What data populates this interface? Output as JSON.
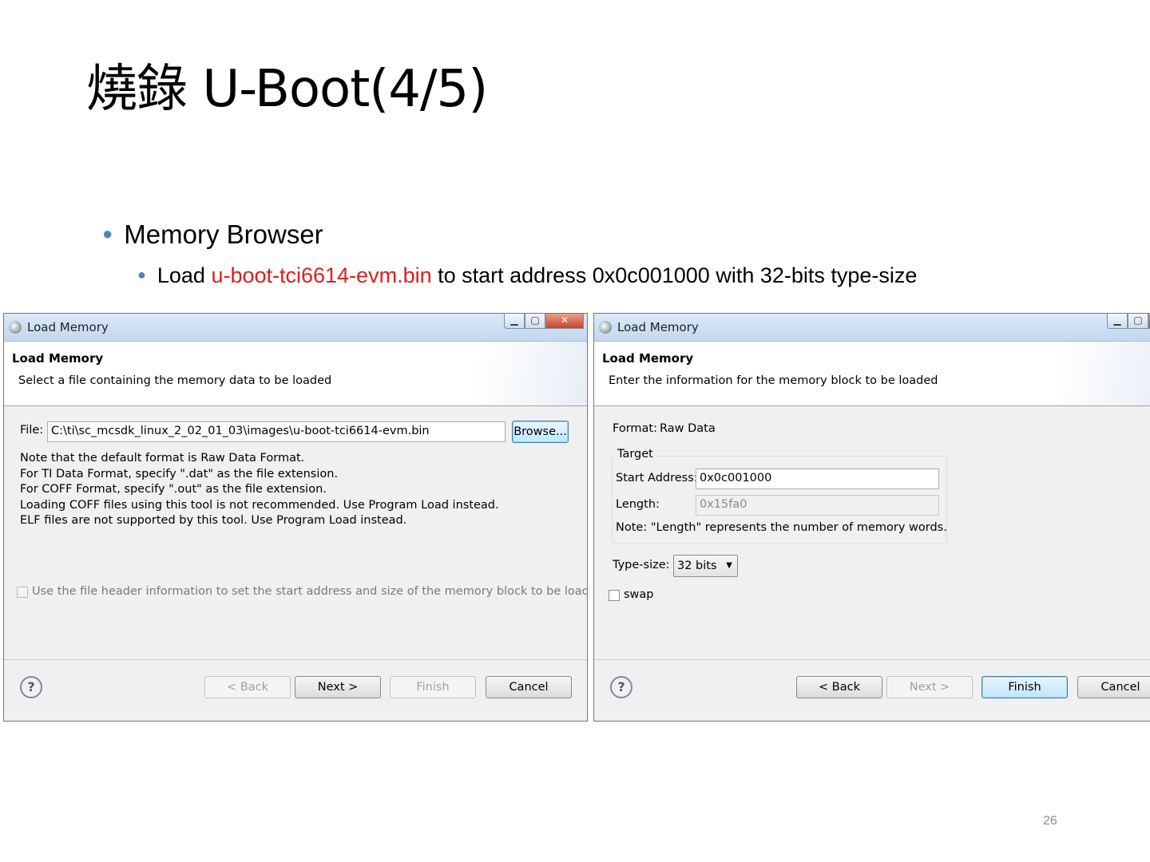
{
  "slide": {
    "title": "燒錄 U-Boot(4/5)",
    "bullet1": "Memory Browser",
    "bullet2_prefix": "Load ",
    "bullet2_highlight": "u-boot-tci6614-evm.bin",
    "bullet2_suffix": " to start address 0x0c001000 with 32-bits type-size",
    "page_number": "26"
  },
  "dialog1": {
    "window_title": "Load Memory",
    "header_title": "Load Memory",
    "header_desc": "Select a file containing the memory data to be loaded",
    "file_label": "File:",
    "file_value": "C:\\ti\\sc_mcsdk_linux_2_02_01_03\\images\\u-boot-tci6614-evm.bin",
    "browse_label": "Browse...",
    "notes": [
      "Note that the default format is Raw Data Format.",
      "For TI Data Format, specify \".dat\" as the file extension.",
      "For COFF Format, specify \".out\" as the file extension.",
      "Loading COFF files using this tool is not recommended. Use Program Load instead.",
      "ELF files are not supported by this tool. Use Program Load instead."
    ],
    "checkbox_label": "Use the file header information to set the start address and size of the memory block to be loaded.",
    "buttons": {
      "back": "< Back",
      "next": "Next >",
      "finish": "Finish",
      "cancel": "Cancel"
    }
  },
  "dialog2": {
    "window_title": "Load Memory",
    "header_title": "Load Memory",
    "header_desc": "Enter the information for the memory block to be loaded",
    "format_label": "Format:",
    "format_value": "Raw Data",
    "group_label": "Target",
    "start_label": "Start Address:",
    "start_value": "0x0c001000",
    "length_label": "Length:",
    "length_value": "0x15fa0",
    "note": "Note: \"Length\" represents the number of memory words.",
    "typesize_label": "Type-size:",
    "typesize_value": "32 bits",
    "swap_label": "swap",
    "buttons": {
      "back": "< Back",
      "next": "Next >",
      "finish": "Finish",
      "cancel": "Cancel"
    }
  },
  "icons": {
    "help": "help-icon",
    "app": "load-memory-icon"
  }
}
